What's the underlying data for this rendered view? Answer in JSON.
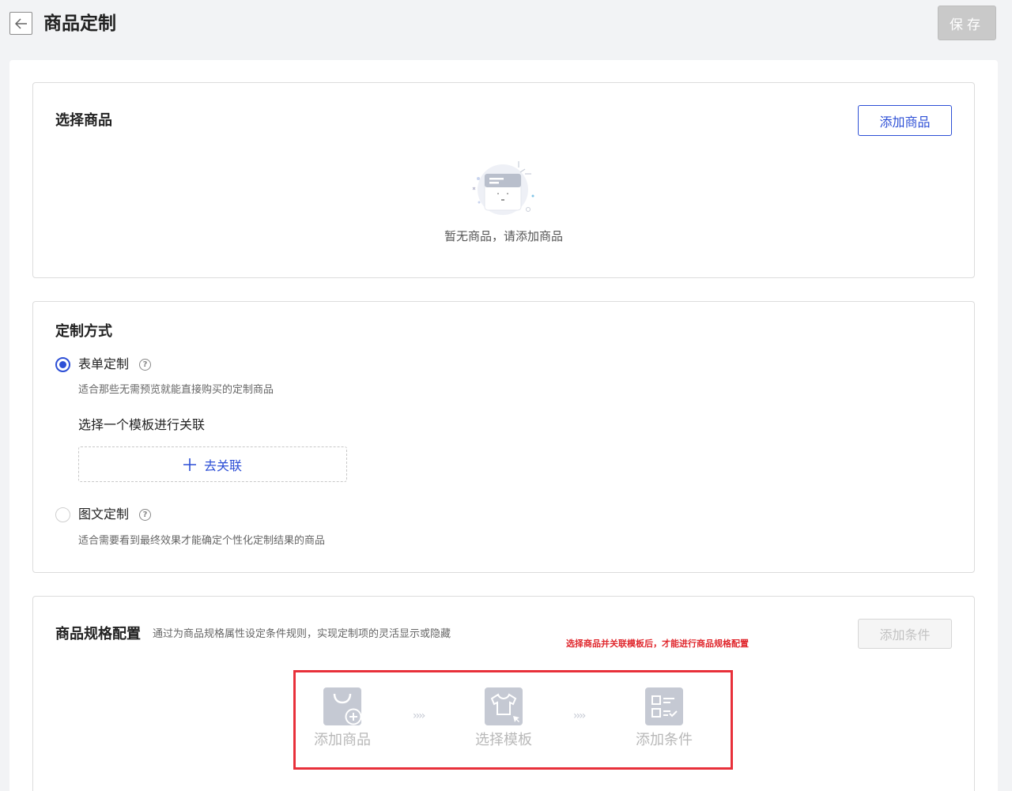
{
  "header": {
    "back_icon": "arrow-left-icon",
    "title": "商品定制",
    "save_label": "保存"
  },
  "select_product": {
    "title": "选择商品",
    "add_button": "添加商品",
    "empty_icon": "empty-box-icon",
    "empty_text": "暂无商品，请添加商品"
  },
  "custom_mode": {
    "title": "定制方式",
    "options": [
      {
        "label": "表单定制",
        "selected": true,
        "description": "适合那些无需预览就能直接购买的定制商品"
      },
      {
        "label": "图文定制",
        "selected": false,
        "description": "适合需要看到最终效果才能确定个性化定制结果的商品"
      }
    ],
    "template_label": "选择一个模板进行关联",
    "link_button": "去关联"
  },
  "spec_config": {
    "title": "商品规格配置",
    "subtitle": "通过为商品规格属性设定条件规则，实现定制项的灵活显示或隐藏",
    "add_condition_button": "添加条件",
    "warning": "选择商品并关联模板后，才能进行商品规格配置",
    "steps": [
      {
        "icon": "shopping-bag-add-icon",
        "label": "添加商品"
      },
      {
        "icon": "tshirt-icon",
        "label": "选择模板"
      },
      {
        "icon": "checklist-icon",
        "label": "添加条件"
      }
    ],
    "arrow_icon": "chevrons-right-icon"
  },
  "colors": {
    "primary": "#2d4fd6",
    "warning": "#e0282e",
    "disabled": "#c9c9c9"
  }
}
